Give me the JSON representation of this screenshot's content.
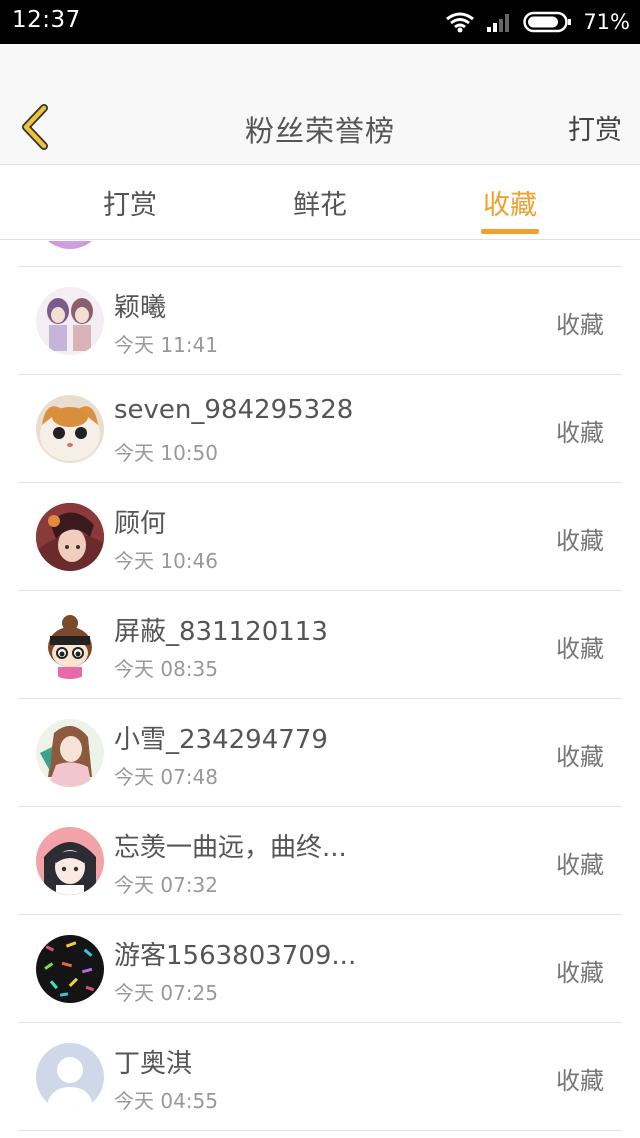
{
  "status_bar": {
    "time": "12:37",
    "battery": "71%"
  },
  "header": {
    "title": "粉丝荣誉榜",
    "action": "打赏"
  },
  "tabs": [
    {
      "label": "打赏",
      "active": false
    },
    {
      "label": "鲜花",
      "active": false
    },
    {
      "label": "收藏",
      "active": true
    }
  ],
  "colors": {
    "accent": "#f0a02e",
    "back_arrow": "#f2c13a"
  },
  "list": [
    {
      "name": "颖曦",
      "time": "今天 11:41",
      "action": "收藏"
    },
    {
      "name": "seven_984295328",
      "time": "今天 10:50",
      "action": "收藏"
    },
    {
      "name": "顾何",
      "time": "今天 10:46",
      "action": "收藏"
    },
    {
      "name": "屏蔽_831120113",
      "time": "今天 08:35",
      "action": "收藏"
    },
    {
      "name": "小雪_234294779",
      "time": "今天 07:48",
      "action": "收藏"
    },
    {
      "name": "忘羡一曲远，曲终...",
      "time": "今天 07:32",
      "action": "收藏"
    },
    {
      "name": "游客1563803709...",
      "time": "今天 07:25",
      "action": "收藏"
    },
    {
      "name": "丁奥淇",
      "time": "今天 04:55",
      "action": "收藏"
    }
  ]
}
